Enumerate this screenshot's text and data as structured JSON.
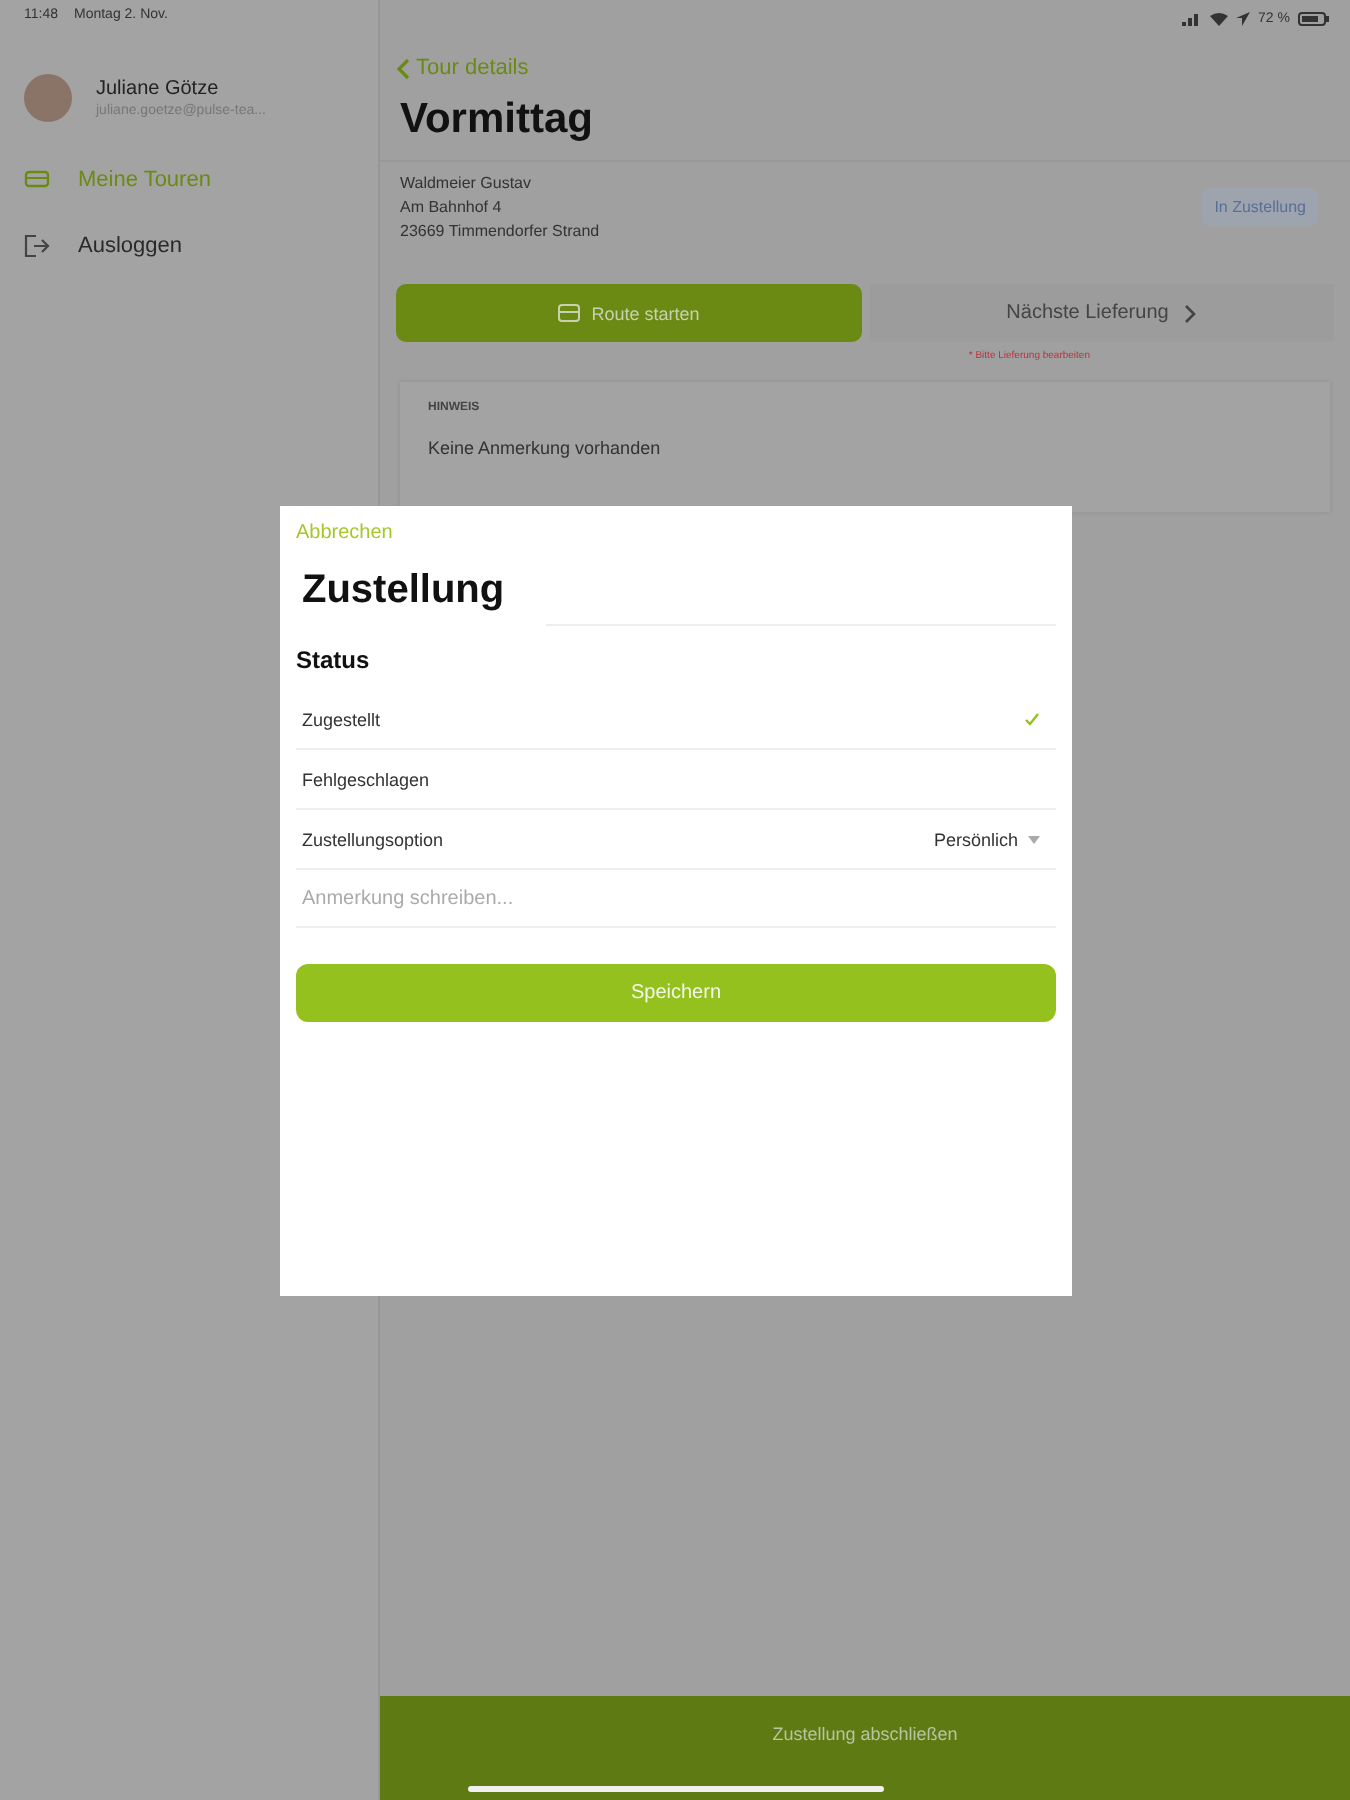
{
  "status_bar": {
    "time": "11:48",
    "date": "Montag 2. Nov.",
    "battery": "72 %"
  },
  "sidebar": {
    "user": {
      "name": "Juliane Götze",
      "email": "juliane.goetze@pulse-tea..."
    },
    "items": [
      {
        "label": "Meine Touren",
        "kind": "tours",
        "selected": true
      },
      {
        "label": "Ausloggen",
        "kind": "logout",
        "selected": false
      }
    ]
  },
  "detail": {
    "back": "Tour details",
    "title": "Vormittag",
    "address": [
      "Waldmeier Gustav",
      "Am Bahnhof 4",
      "23669 Timmendorfer Strand"
    ],
    "badge": "In Zustellung",
    "route_button": "Route starten",
    "next_button": "Nächste Lieferung",
    "warning": "* Bitte Lieferung bearbeiten",
    "note": {
      "heading": "HINWEIS",
      "text": "Keine Anmerkung vorhanden"
    },
    "footer_button": "Zustellung abschließen"
  },
  "dialog": {
    "cancel": "Abbrechen",
    "title": "Zustellung",
    "section": "Status",
    "options": [
      {
        "label": "Zugestellt",
        "selected": true
      },
      {
        "label": "Fehlgeschlagen",
        "selected": false
      }
    ],
    "delivery_option": {
      "label": "Zustellungsoption",
      "value": "Persönlich"
    },
    "note": {
      "placeholder": "Anmerkung schreiben..."
    },
    "save": "Speichern"
  }
}
